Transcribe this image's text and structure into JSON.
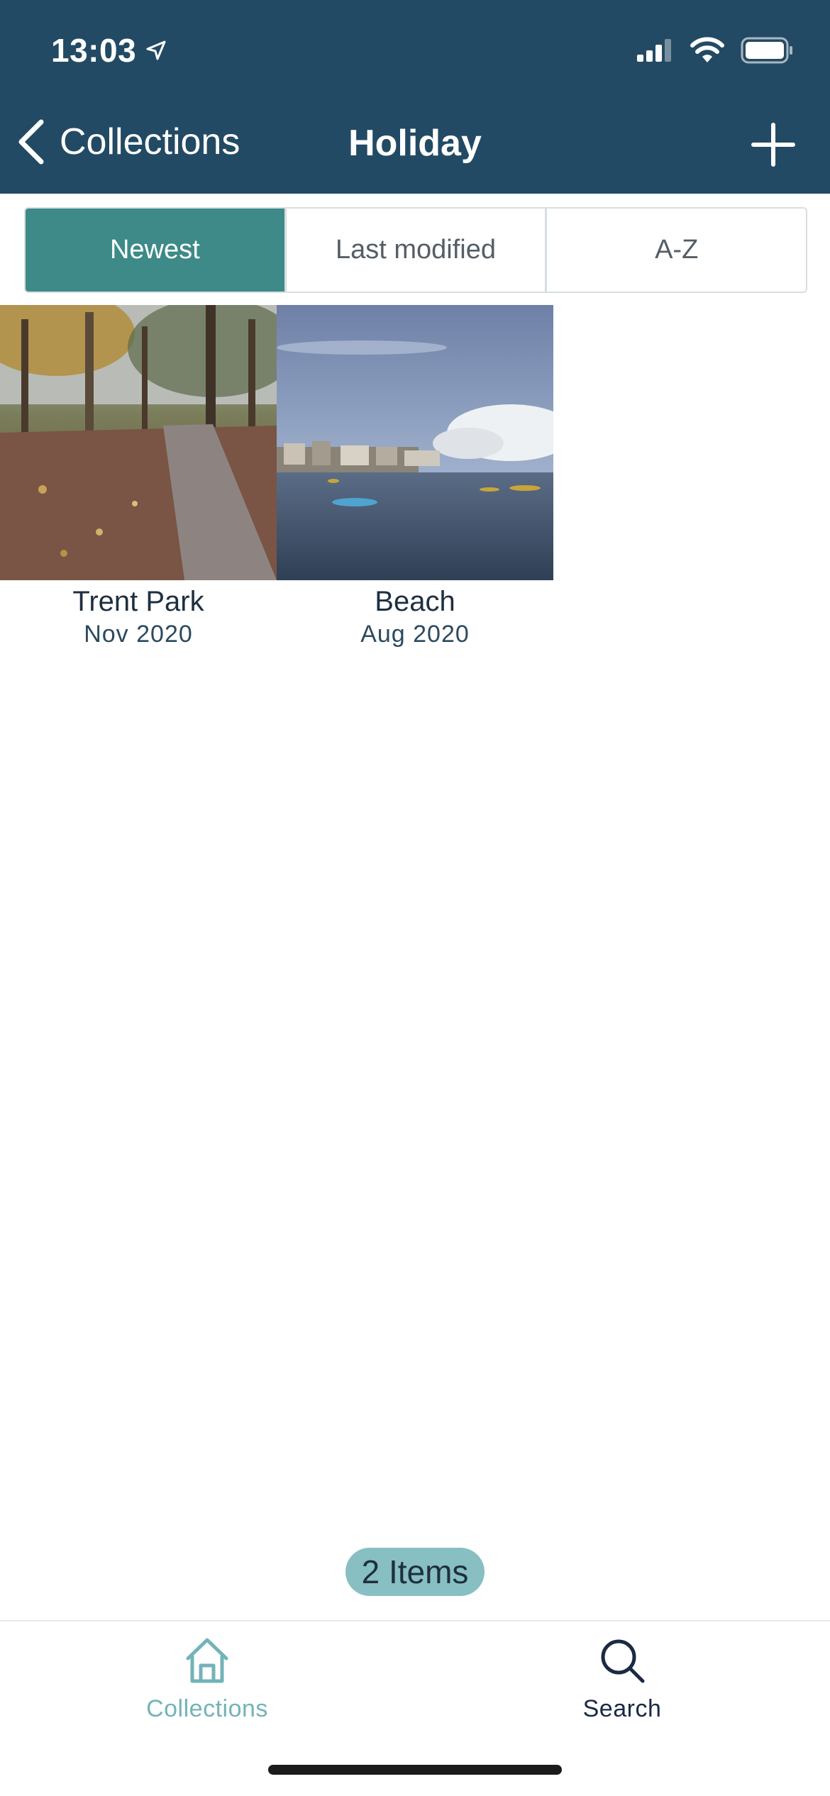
{
  "status_bar": {
    "time": "13:03"
  },
  "nav": {
    "back_label": "Collections",
    "title": "Holiday"
  },
  "sort_tabs": [
    {
      "label": "Newest",
      "selected": true
    },
    {
      "label": "Last modified",
      "selected": false
    },
    {
      "label": "A-Z",
      "selected": false
    }
  ],
  "items": [
    {
      "title": "Trent Park",
      "date": "Nov 2020"
    },
    {
      "title": "Beach",
      "date": "Aug 2020"
    }
  ],
  "count_label": "2 Items",
  "tabbar": {
    "collections_label": "Collections",
    "search_label": "Search"
  },
  "colors": {
    "header_bg": "#234a64",
    "accent": "#3d8a88",
    "badge": "#87bfc3"
  }
}
